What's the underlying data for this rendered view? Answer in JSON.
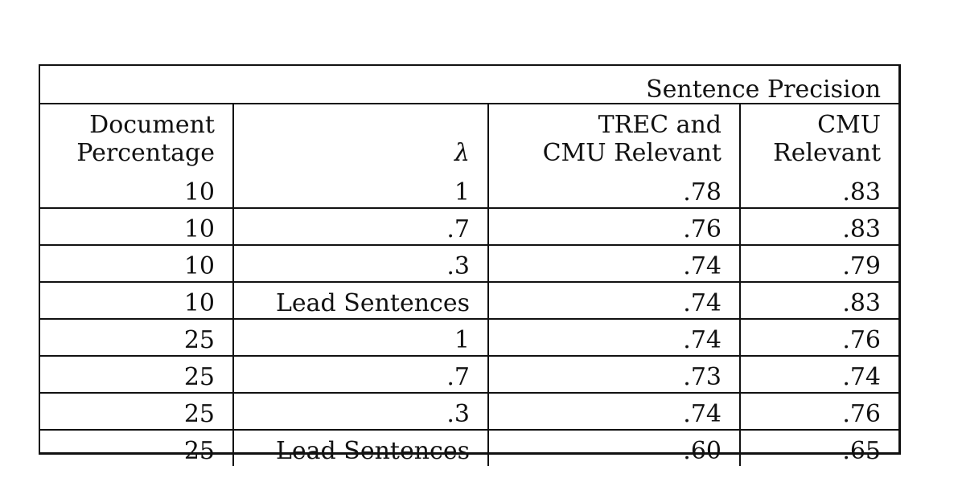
{
  "table": {
    "title": "Sentence Precision",
    "headers": [
      {
        "line1": "Document",
        "line2": "Percentage"
      },
      {
        "line1": "",
        "line2": "λ"
      },
      {
        "line1": "TREC and",
        "line2": "CMU Relevant"
      },
      {
        "line1": "CMU",
        "line2": "Relevant"
      }
    ],
    "rows": [
      [
        "10",
        "1",
        ".78",
        ".83"
      ],
      [
        "10",
        ".7",
        ".76",
        ".83"
      ],
      [
        "10",
        ".3",
        ".74",
        ".79"
      ],
      [
        "10",
        "Lead Sentences",
        ".74",
        ".83"
      ],
      [
        "25",
        "1",
        ".74",
        ".76"
      ],
      [
        "25",
        ".7",
        ".73",
        ".74"
      ],
      [
        "25",
        ".3",
        ".74",
        ".76"
      ],
      [
        "25",
        "Lead Sentences",
        ".60",
        ".65"
      ]
    ]
  }
}
